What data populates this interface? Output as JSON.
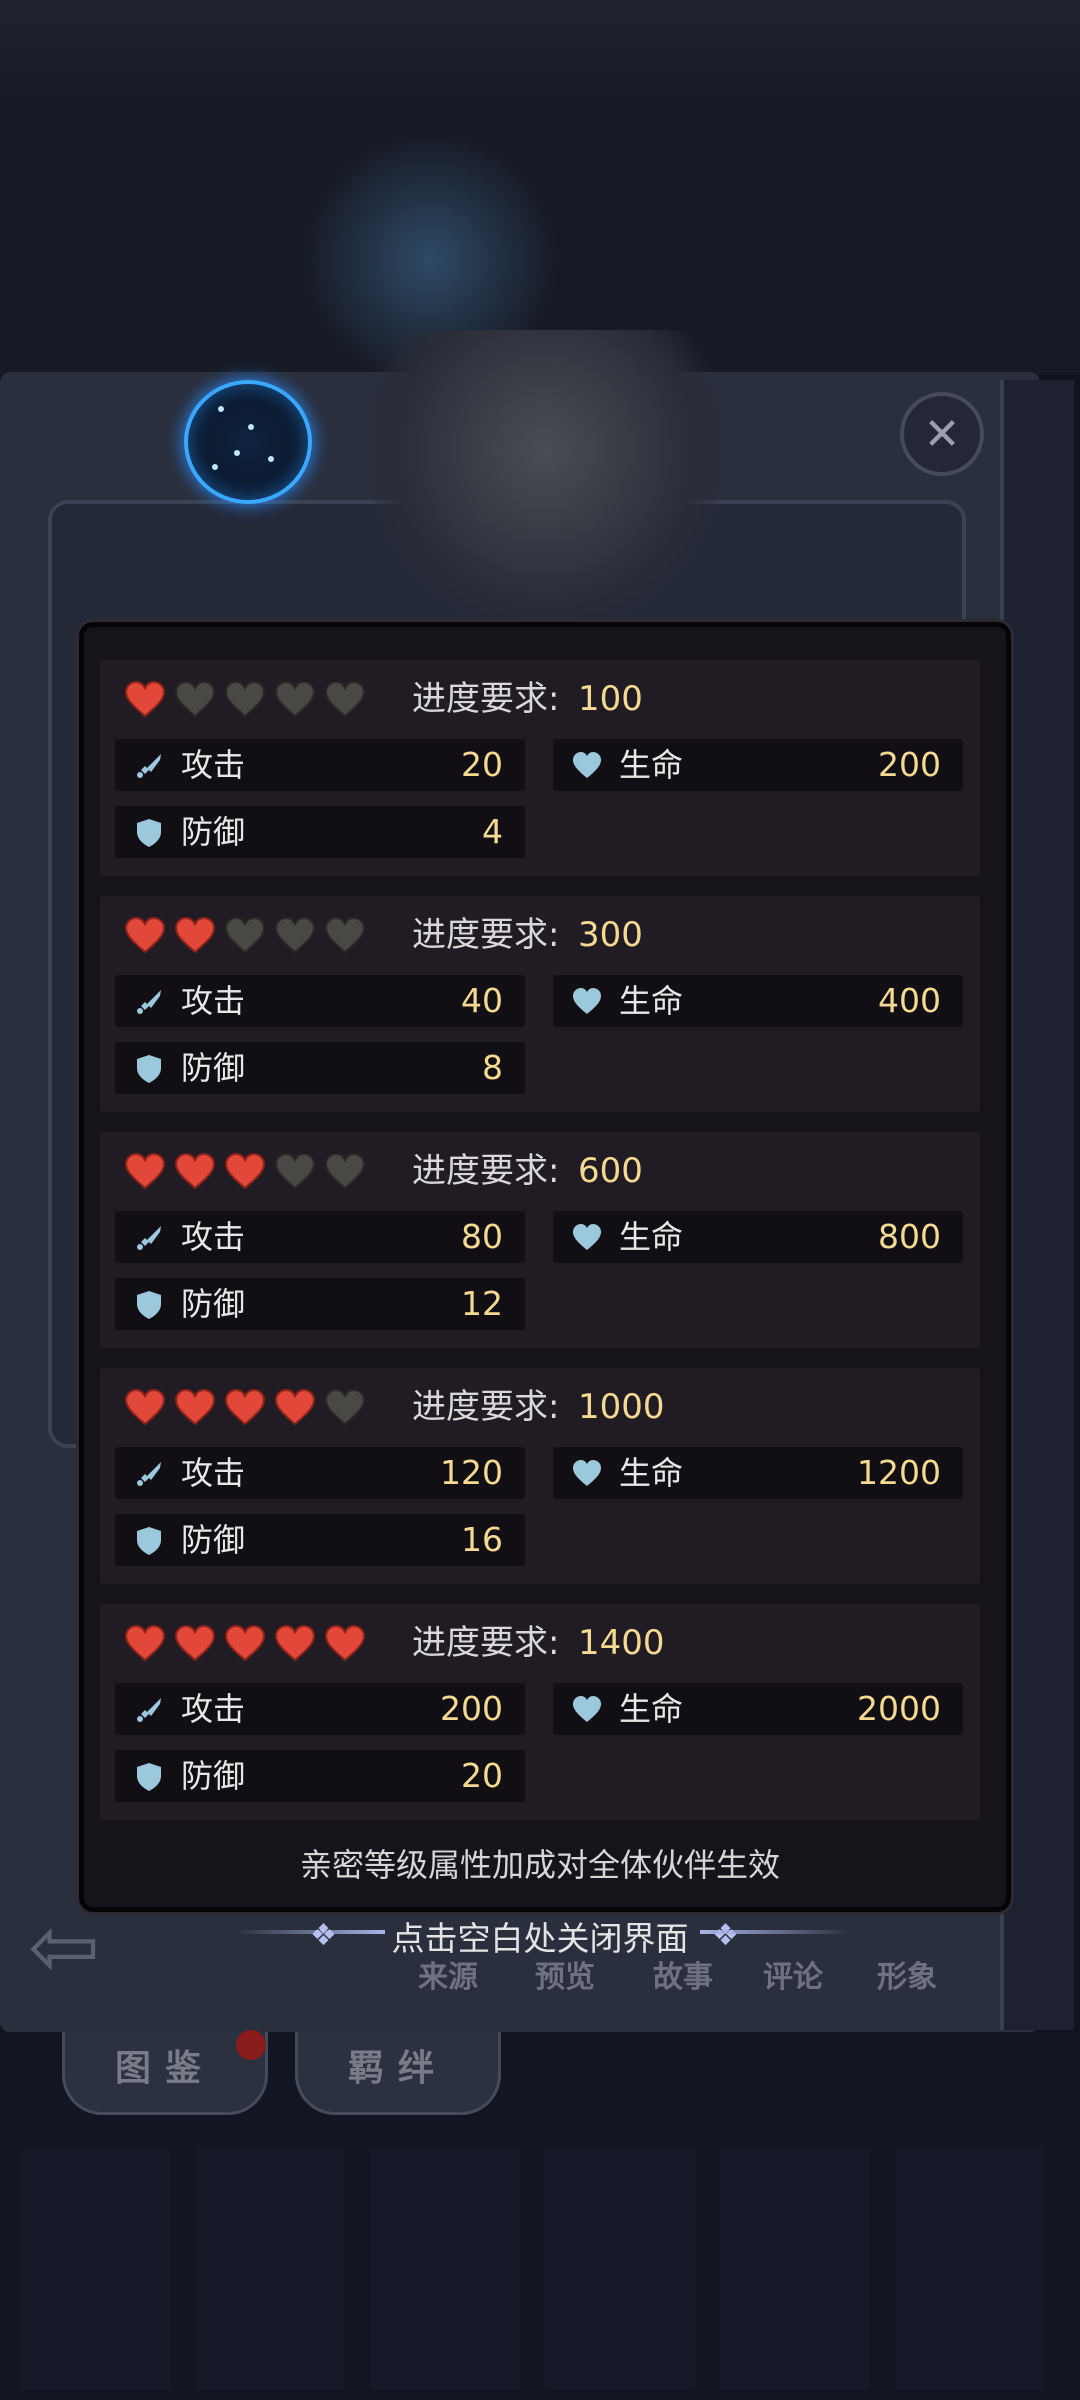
{
  "tiers": [
    {
      "filled_hearts": 1,
      "req_label": "进度要求:",
      "req_value": "100",
      "atk_label": "攻击",
      "atk_value": "20",
      "hp_label": "生命",
      "hp_value": "200",
      "def_label": "防御",
      "def_value": "4"
    },
    {
      "filled_hearts": 2,
      "req_label": "进度要求:",
      "req_value": "300",
      "atk_label": "攻击",
      "atk_value": "40",
      "hp_label": "生命",
      "hp_value": "400",
      "def_label": "防御",
      "def_value": "8"
    },
    {
      "filled_hearts": 3,
      "req_label": "进度要求:",
      "req_value": "600",
      "atk_label": "攻击",
      "atk_value": "80",
      "hp_label": "生命",
      "hp_value": "800",
      "def_label": "防御",
      "def_value": "12"
    },
    {
      "filled_hearts": 4,
      "req_label": "进度要求:",
      "req_value": "1000",
      "atk_label": "攻击",
      "atk_value": "120",
      "hp_label": "生命",
      "hp_value": "1200",
      "def_label": "防御",
      "def_value": "16"
    },
    {
      "filled_hearts": 5,
      "req_label": "进度要求:",
      "req_value": "1400",
      "atk_label": "攻击",
      "atk_value": "200",
      "hp_label": "生命",
      "hp_value": "2000",
      "def_label": "防御",
      "def_value": "20"
    }
  ],
  "max_hearts": 5,
  "footnote": "亲密等级属性加成对全体伙伴生效",
  "close_hint": "点击空白处关闭界面",
  "bottom_nav": [
    "来源",
    "预览",
    "故事",
    "评论",
    "形象"
  ],
  "tabs": [
    "图鉴",
    "羁绊"
  ],
  "colors": {
    "heart_filled": "#e2483a",
    "heart_empty": "#4a4845",
    "value_gold": "#f3d992",
    "icon_blue": "#9cc8dc"
  }
}
